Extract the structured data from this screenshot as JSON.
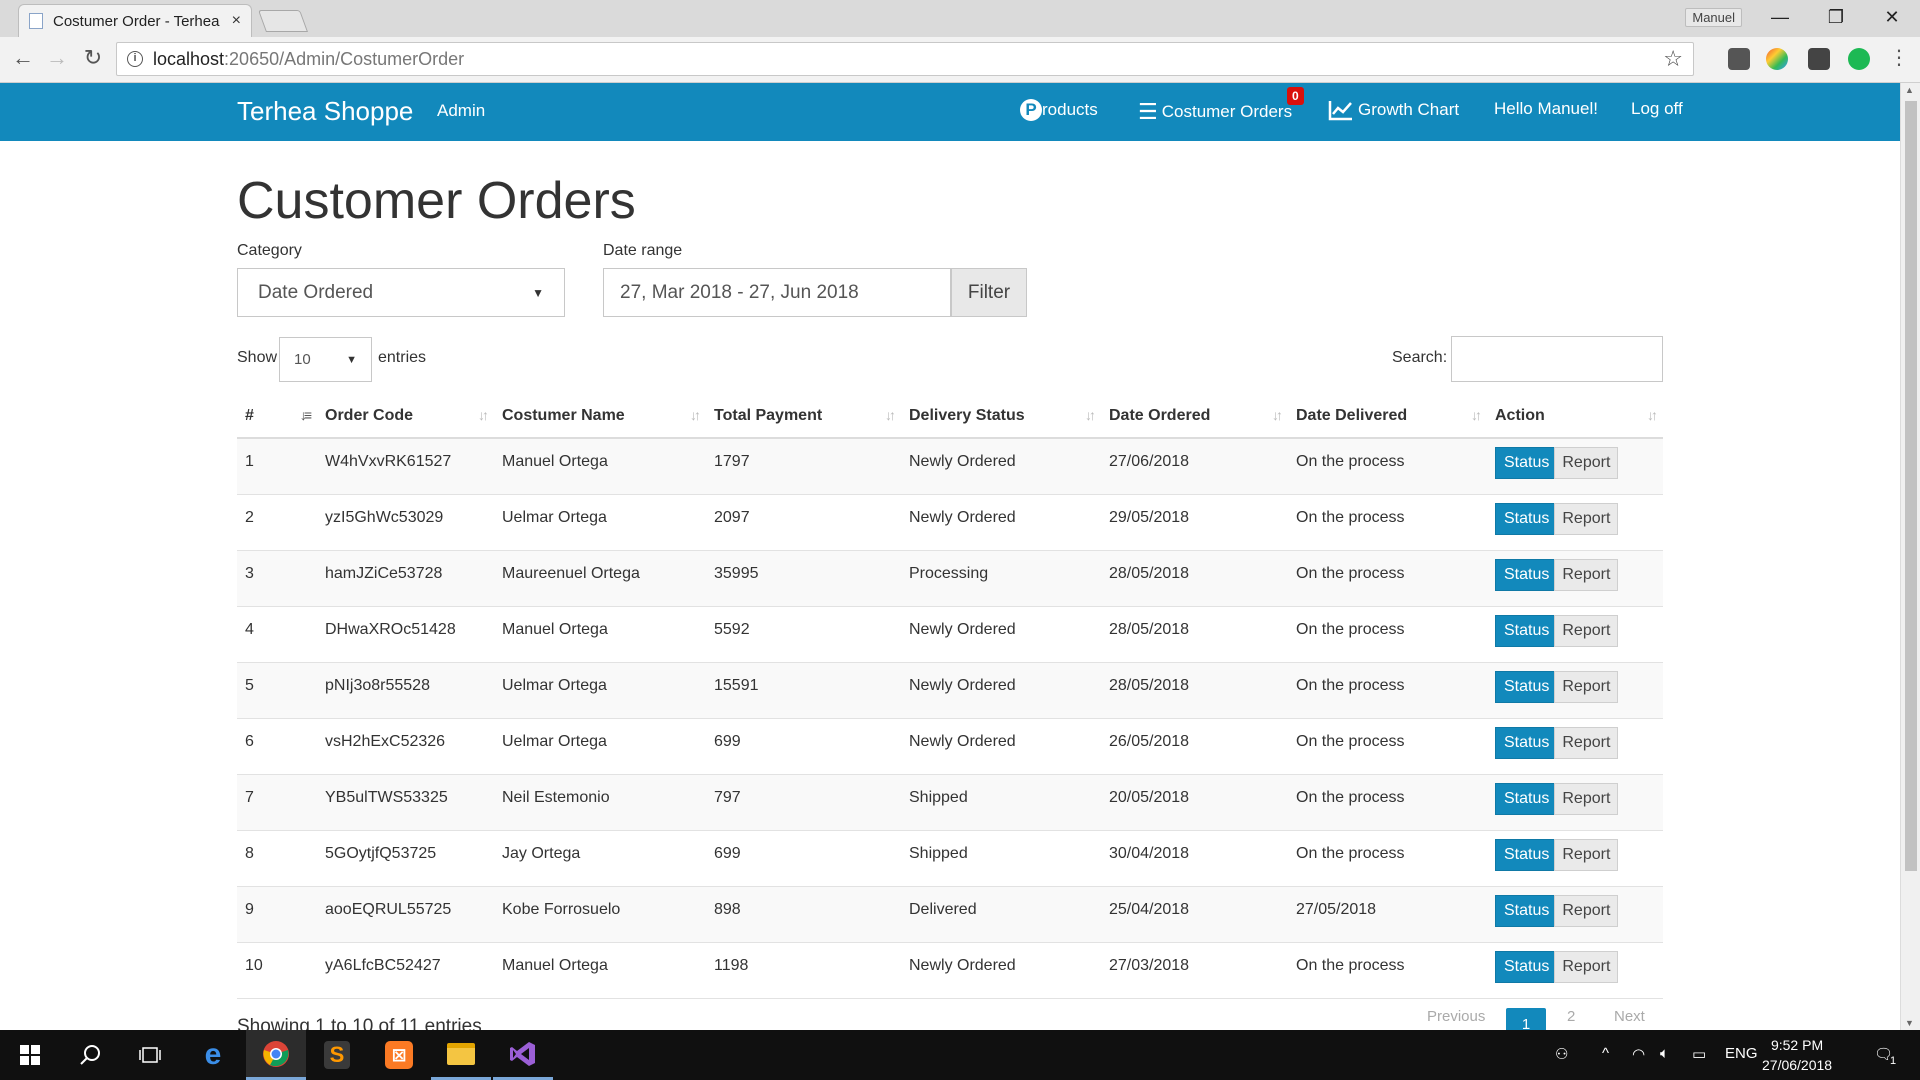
{
  "browser": {
    "tab_title": "Costumer Order - Terhea",
    "tab_close": "×",
    "user_label": "Manuel",
    "url_host": "localhost",
    "url_path": ":20650/Admin/CostumerOrder",
    "window_controls": {
      "minimize": "—",
      "maximize": "❐",
      "close": "✕"
    },
    "nav": {
      "back": "←",
      "forward": "→",
      "reload": "↻",
      "info": "i",
      "star": "☆"
    }
  },
  "navbar": {
    "brand": "Terhea Shoppe",
    "admin": "Admin",
    "products": "roducts",
    "products_icon_letter": "P",
    "orders": "Costumer Orders",
    "orders_badge": "0",
    "growth": "Growth Chart",
    "greeting": "Hello Manuel!",
    "logoff": "Log off",
    "colors": {
      "bar": "#1289bc",
      "badge": "#d9100b"
    }
  },
  "page": {
    "title": "Customer Orders",
    "category_label": "Category",
    "category_value": "Date Ordered",
    "date_label": "Date range",
    "date_value": "27, Mar 2018 - 27, Jun 2018",
    "filter_button": "Filter",
    "show_label": "Show",
    "entries_value": "10",
    "entries_label": "entries",
    "search_label": "Search:",
    "showing_text": "Showing 1 to 10 of 11 entries",
    "pager": {
      "previous": "Previous",
      "page1": "1",
      "page2": "2",
      "next": "Next"
    }
  },
  "table": {
    "headers": [
      "#",
      "Order Code",
      "Costumer Name",
      "Total Payment",
      "Delivery Status",
      "Date Ordered",
      "Date Delivered",
      "Action"
    ],
    "status_label": "Status",
    "report_label": "Report",
    "rows": [
      [
        "1",
        "W4hVxvRK61527",
        "Manuel Ortega",
        "1797",
        "Newly Ordered",
        "27/06/2018",
        "On the process"
      ],
      [
        "2",
        "yzI5GhWc53029",
        "Uelmar Ortega",
        "2097",
        "Newly Ordered",
        "29/05/2018",
        "On the process"
      ],
      [
        "3",
        "hamJZiCe53728",
        "Maureenuel Ortega",
        "35995",
        "Processing",
        "28/05/2018",
        "On the process"
      ],
      [
        "4",
        "DHwaXROc51428",
        "Manuel Ortega",
        "5592",
        "Newly Ordered",
        "28/05/2018",
        "On the process"
      ],
      [
        "5",
        "pNIj3o8r55528",
        "Uelmar Ortega",
        "15591",
        "Newly Ordered",
        "28/05/2018",
        "On the process"
      ],
      [
        "6",
        "vsH2hExC52326",
        "Uelmar Ortega",
        "699",
        "Newly Ordered",
        "26/05/2018",
        "On the process"
      ],
      [
        "7",
        "YB5ulTWS53325",
        "Neil Estemonio",
        "797",
        "Shipped",
        "20/05/2018",
        "On the process"
      ],
      [
        "8",
        "5GOytjfQ53725",
        "Jay Ortega",
        "699",
        "Shipped",
        "30/04/2018",
        "On the process"
      ],
      [
        "9",
        "aooEQRUL55725",
        "Kobe Forrosuelo",
        "898",
        "Delivered",
        "25/04/2018",
        "27/05/2018"
      ],
      [
        "10",
        "yA6LfcBC52427",
        "Manuel Ortega",
        "1198",
        "Newly Ordered",
        "27/03/2018",
        "On the process"
      ]
    ]
  },
  "taskbar": {
    "lang": "ENG",
    "time": "9:52 PM",
    "date": "27/06/2018",
    "notif_count": "1"
  }
}
